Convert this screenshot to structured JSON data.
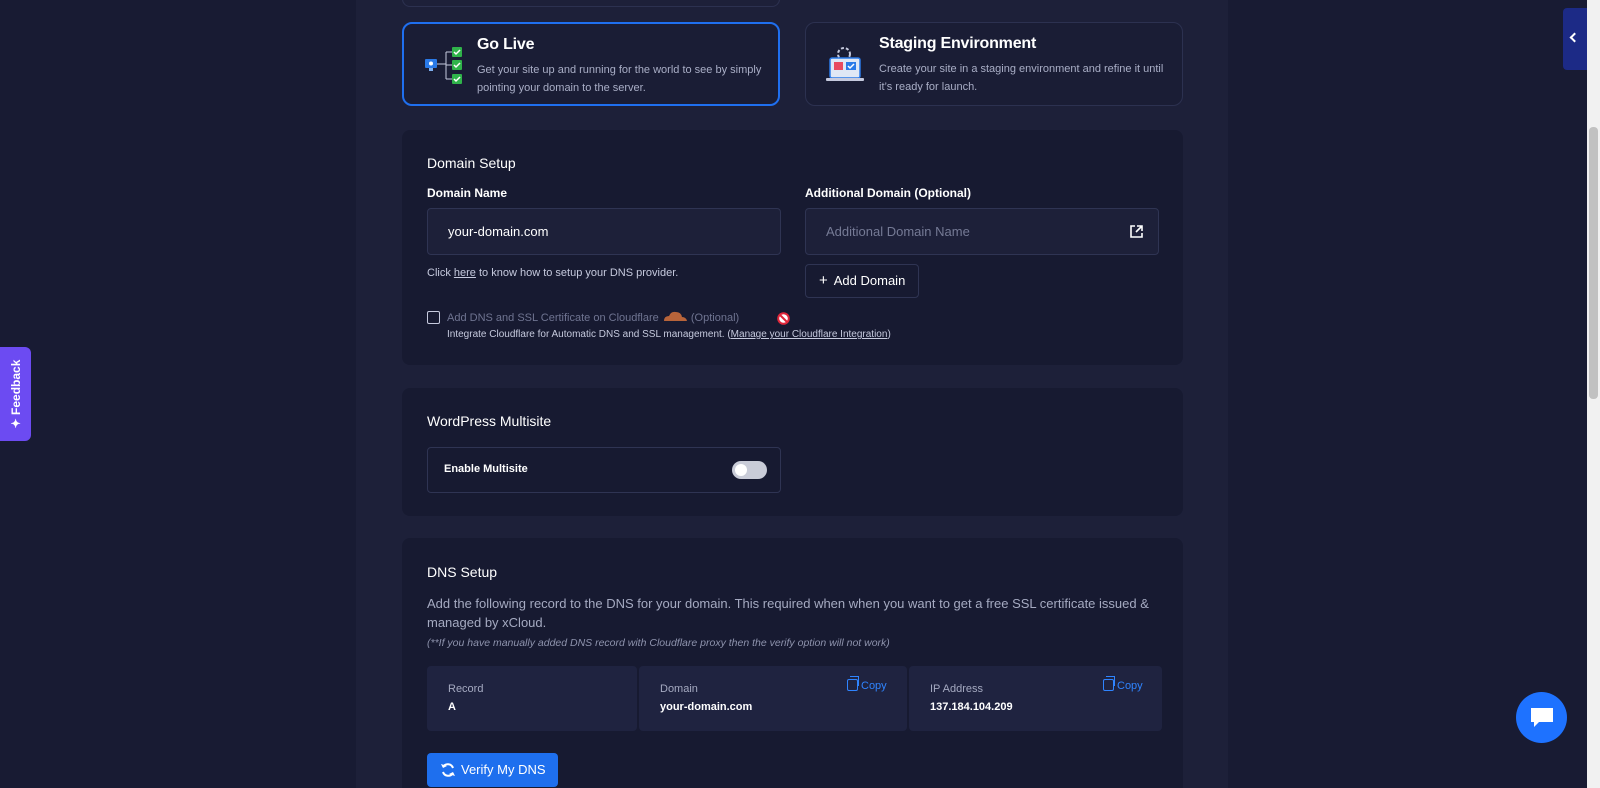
{
  "environments": {
    "go_live": {
      "title": "Go Live",
      "desc": "Get your site up and running for the world to see by simply pointing your domain to the server."
    },
    "staging": {
      "title": "Staging Environment",
      "desc": "Create your site in a staging environment and refine it until it’s ready for launch."
    }
  },
  "domain_setup": {
    "title": "Domain Setup",
    "domain_name_label": "Domain Name",
    "domain_name_value": "your-domain.com",
    "additional_label": "Additional Domain (Optional)",
    "additional_placeholder": "Additional Domain Name",
    "help_prefix": "Click",
    "help_link": "here",
    "help_suffix": "to know how to setup your DNS provider.",
    "add_domain_label": "Add Domain",
    "cloudflare_label": "Add DNS and SSL Certificate on Cloudflare",
    "cloudflare_optional": "(Optional)",
    "cloudflare_desc": "Integrate Cloudflare for Automatic DNS and SSL management.",
    "cloudflare_link": "Manage your Cloudflare Integration"
  },
  "multisite": {
    "title": "WordPress Multisite",
    "toggle_label": "Enable Multisite",
    "enabled": false
  },
  "dns_setup": {
    "title": "DNS Setup",
    "text": "Add the following record to the DNS for your domain. This required when when you want to get a free SSL certificate issued & managed by xCloud.",
    "note": "(**If you have manually added DNS record with Cloudflare proxy then the verify option will not work)",
    "record_header": "Record",
    "record_value": "A",
    "domain_header": "Domain",
    "domain_value": "your-domain.com",
    "ip_header": "IP Address",
    "ip_value": "137.184.104.209",
    "copy_label": "Copy",
    "verify_label": "Verify My DNS"
  },
  "feedback_label": "Feedback",
  "colors": {
    "accent": "#1e6fee",
    "feedback": "#6c4bf2",
    "background": "#181b33"
  }
}
